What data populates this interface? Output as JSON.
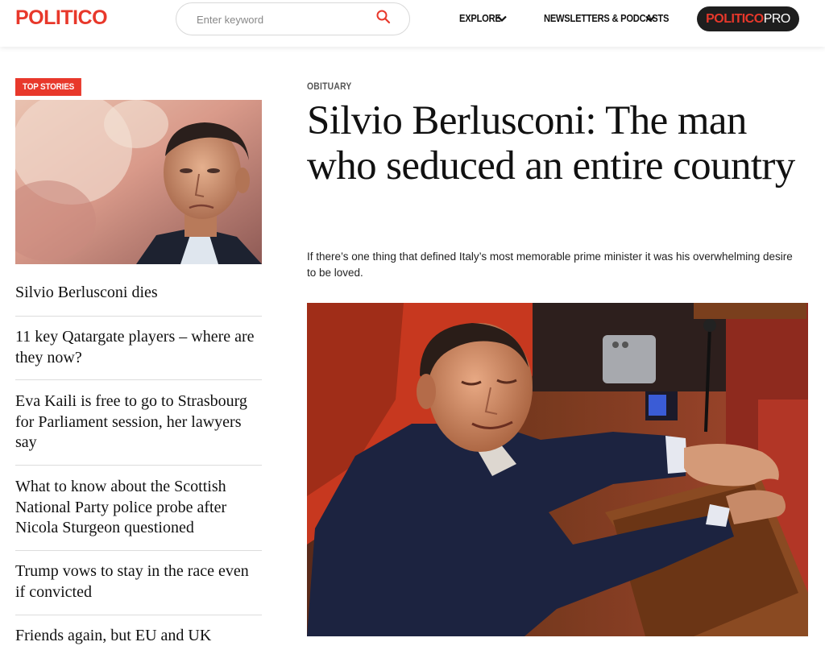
{
  "header": {
    "logo": "POLITICO",
    "search_placeholder": "Enter keyword",
    "nav": [
      {
        "label": "EXPLORE"
      },
      {
        "label": "NEWSLETTERS & PODCASTS"
      }
    ],
    "pro_button": {
      "part1": "POLITICO",
      "part2": "PRO"
    }
  },
  "sidebar": {
    "badge": "TOP STORIES",
    "stories": [
      {
        "title": "Silvio Berlusconi dies"
      },
      {
        "title": "11 key Qatargate players – where are they now?"
      },
      {
        "title": "Eva Kaili is free to go to Strasbourg for Parliament session, her lawyers say"
      },
      {
        "title": "What to know about the Scottish National Party police probe after Nicola Sturgeon questioned"
      },
      {
        "title": "Trump vows to stay in the race even if convicted"
      },
      {
        "title": "Friends again, but EU and UK"
      }
    ]
  },
  "article": {
    "kicker": "OBITUARY",
    "headline": "Silvio Berlusconi: The man who seduced an entire country",
    "dek": "If there’s one thing that defined Italy’s most memorable prime minister it was his overwhelming desire to be loved."
  },
  "colors": {
    "brand_red": "#e8382b",
    "pro_bg": "#1e1e1e"
  }
}
